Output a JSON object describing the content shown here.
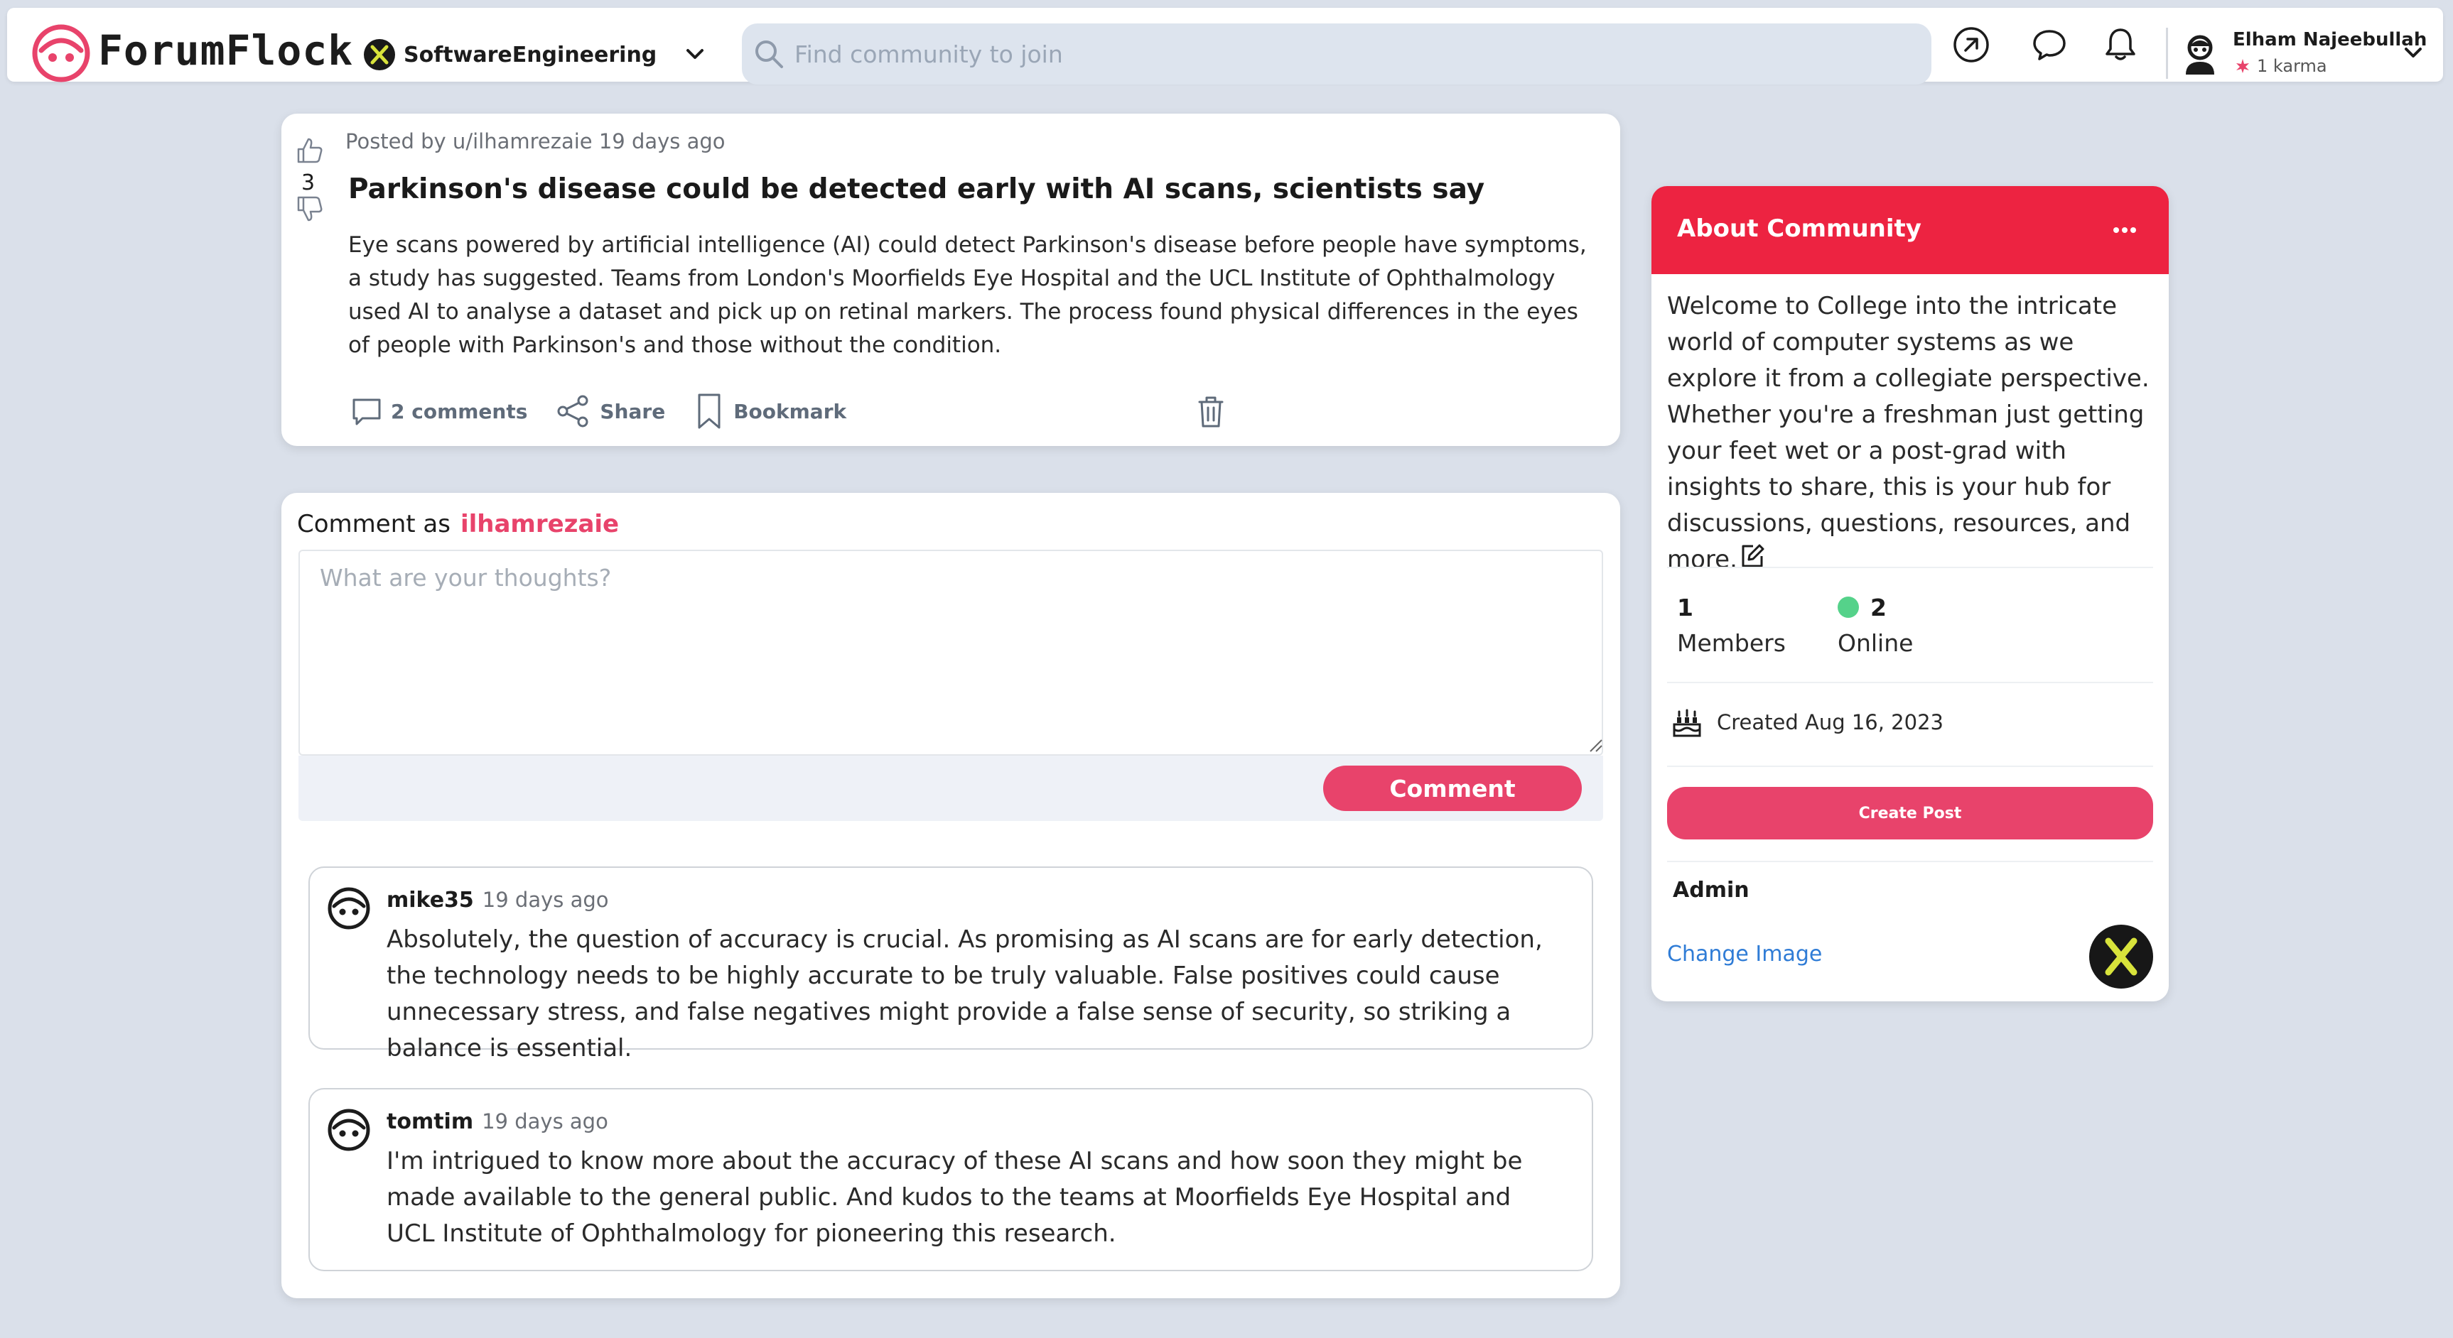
{
  "header": {
    "logo_text": "ForumFlock",
    "community": "SoftwareEngineering",
    "search_placeholder": "Find community to join",
    "user": {
      "name": "Elham Najeebullah",
      "karma": "1 karma"
    }
  },
  "post": {
    "meta": "Posted by u/ilhamrezaie 19 days ago",
    "vote_count": "3",
    "title": "Parkinson's disease could be detected early with AI scans, scientists say",
    "body": "Eye scans powered by artificial intelligence (AI) could detect Parkinson's disease before people have symptoms, a study has suggested. Teams from London's Moorfields Eye Hospital and the UCL Institute of Ophthalmology used AI to analyse a dataset and pick up on retinal markers. The process found physical differences in the eyes of people with Parkinson's and those without the condition.",
    "actions": {
      "comments": "2 comments",
      "share": "Share",
      "bookmark": "Bookmark"
    }
  },
  "comment_form": {
    "prefix": "Comment as",
    "username": "ilhamrezaie",
    "placeholder": "What are your thoughts?",
    "button": "Comment"
  },
  "comments": [
    {
      "author": "mike35",
      "time": "19 days ago",
      "text": "Absolutely, the question of accuracy is crucial. As promising as AI scans are for early detection, the technology needs to be highly accurate to be truly valuable. False positives could cause unnecessary stress, and false negatives might provide a false sense of security, so striking a balance is essential."
    },
    {
      "author": "tomtim",
      "time": "19 days ago",
      "text": "I'm intrigued to know more about the accuracy of these AI scans and how soon they might be made available to the general public. And kudos to the teams at Moorfields Eye Hospital and UCL Institute of Ophthalmology for pioneering this research."
    }
  ],
  "about": {
    "title": "About Community",
    "description": "Welcome to College into the intricate world of computer systems as we explore it from a collegiate perspective. Whether you're a freshman just getting your feet wet or a post-grad with insights to share, this is your hub for discussions, questions, resources, and more.",
    "members_count": "1",
    "members_label": "Members",
    "online_count": "2",
    "online_label": "Online",
    "created": "Created Aug 16, 2023",
    "create_post": "Create Post",
    "admin_label": "Admin",
    "change_image": "Change Image"
  },
  "colors": {
    "brand": "#e8436b",
    "about_header": "#ed2341",
    "online": "#55d28a",
    "link": "#2f7cd6",
    "page_bg": "#dae0ea"
  },
  "icons": {
    "logo": "forumflock-logo-icon",
    "popular": "arrow-up-right-circle-icon",
    "chat": "chat-bubble-icon",
    "notifications": "bell-icon",
    "upvote": "thumbs-up-icon",
    "downvote": "thumbs-down-icon",
    "comment": "comment-icon",
    "share": "share-icon",
    "bookmark": "bookmark-icon",
    "delete": "trash-icon",
    "edit": "edit-icon",
    "cake": "cake-icon"
  }
}
